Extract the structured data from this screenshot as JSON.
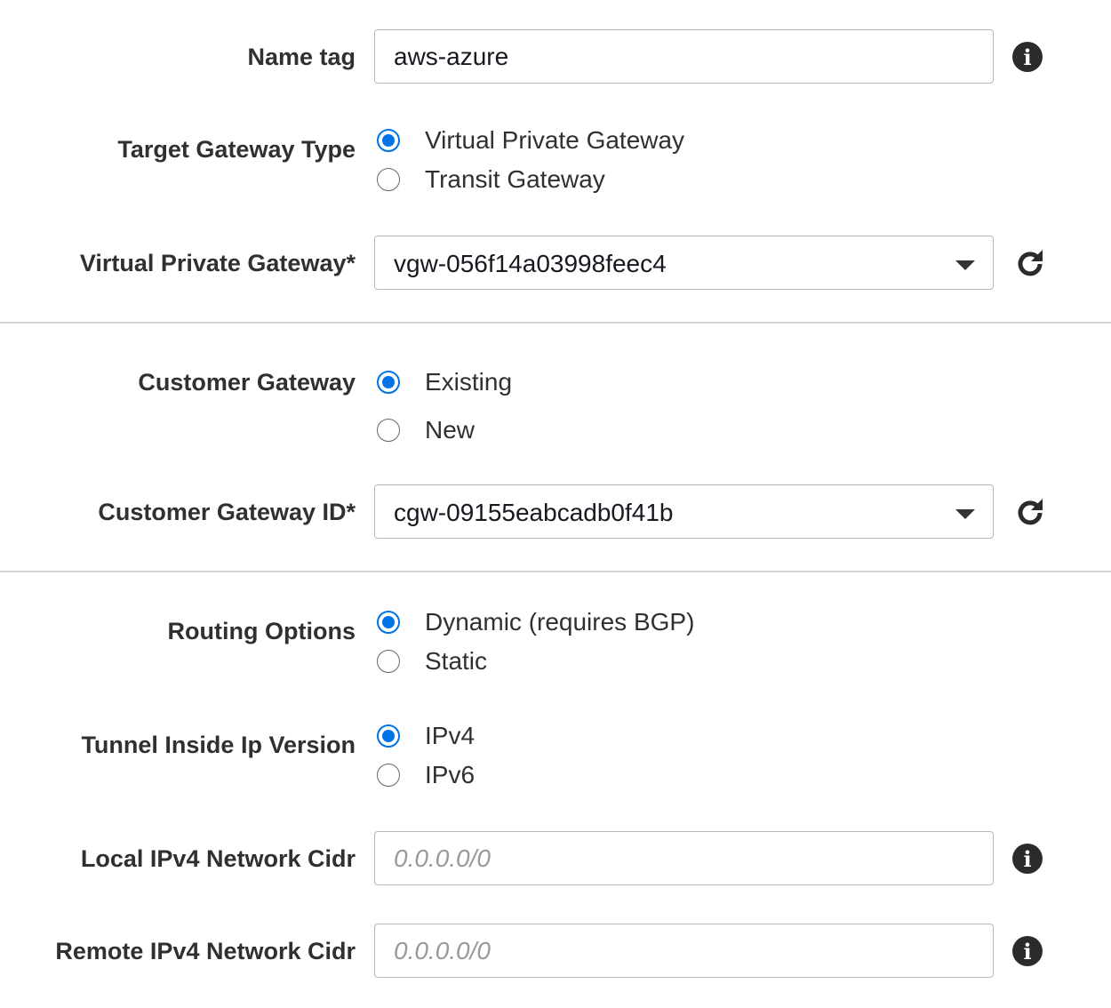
{
  "form": {
    "name_tag": {
      "label": "Name tag",
      "value": "aws-azure",
      "info_icon": "info-icon"
    },
    "target_gateway_type": {
      "label": "Target Gateway Type",
      "options": [
        {
          "label": "Virtual Private Gateway",
          "checked": true
        },
        {
          "label": "Transit Gateway",
          "checked": false
        }
      ]
    },
    "virtual_private_gateway": {
      "label": "Virtual Private Gateway*",
      "selected": "vgw-056f14a03998feec4",
      "refresh_icon": "refresh-icon"
    },
    "customer_gateway": {
      "label": "Customer Gateway",
      "options": [
        {
          "label": "Existing",
          "checked": true
        },
        {
          "label": "New",
          "checked": false
        }
      ]
    },
    "customer_gateway_id": {
      "label": "Customer Gateway ID*",
      "selected": "cgw-09155eabcadb0f41b",
      "refresh_icon": "refresh-icon"
    },
    "routing_options": {
      "label": "Routing Options",
      "options": [
        {
          "label": "Dynamic (requires BGP)",
          "checked": true
        },
        {
          "label": "Static",
          "checked": false
        }
      ]
    },
    "tunnel_inside_ip_version": {
      "label": "Tunnel Inside Ip Version",
      "options": [
        {
          "label": "IPv4",
          "checked": true
        },
        {
          "label": "IPv6",
          "checked": false
        }
      ]
    },
    "local_ipv4_network_cidr": {
      "label": "Local IPv4 Network Cidr",
      "value": "",
      "placeholder": "0.0.0.0/0",
      "info_icon": "info-icon"
    },
    "remote_ipv4_network_cidr": {
      "label": "Remote IPv4 Network Cidr",
      "value": "",
      "placeholder": "0.0.0.0/0",
      "info_icon": "info-icon"
    }
  },
  "colors": {
    "accent": "#0073e6",
    "border": "#b8b8b8",
    "divider": "#d5d5d5",
    "label": "#303030"
  }
}
